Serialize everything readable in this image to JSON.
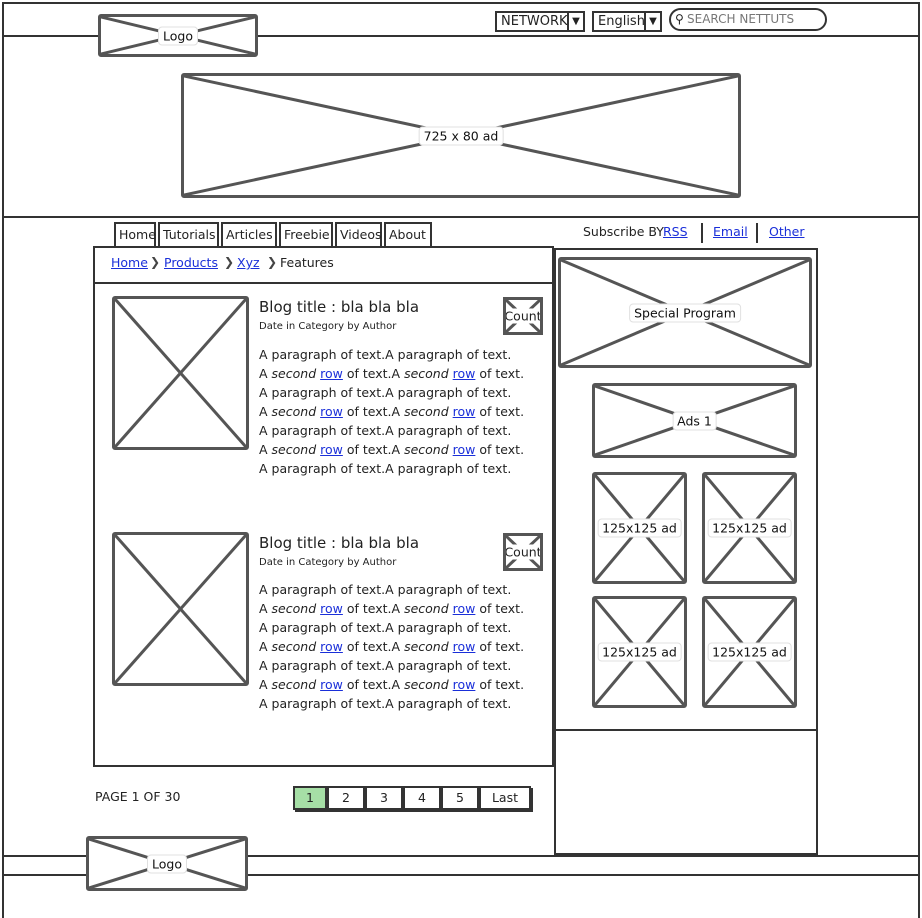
{
  "header": {
    "logo_label": "Logo",
    "network_label": "NETWORK",
    "language_label": "English",
    "search_placeholder": "SEARCH NETTUTS",
    "banner_ad_label": "725 x 80 ad"
  },
  "nav": {
    "tabs": [
      {
        "label": "Home"
      },
      {
        "label": "Tutorials"
      },
      {
        "label": "Articles"
      },
      {
        "label": "Freebie"
      },
      {
        "label": "Videos"
      },
      {
        "label": "About"
      }
    ]
  },
  "subscribe": {
    "prefix": "Subscribe BY",
    "links": [
      "RSS",
      "Email",
      "Other"
    ]
  },
  "breadcrumb": {
    "links": [
      "Home",
      "Products",
      "Xyz"
    ],
    "current": "Features"
  },
  "posts": [
    {
      "title": "Blog title : bla bla bla",
      "meta": "Date in Category by Author",
      "count_label": "Count",
      "line_a": "A paragraph of text.A paragraph of text.",
      "line_b": {
        "a": "A",
        "second": "second",
        "row": "row",
        "mid": "of text.A",
        "end": "of text."
      }
    },
    {
      "title": "Blog title : bla bla bla",
      "meta": "Date in Category by Author",
      "count_label": "Count",
      "line_a": "A paragraph of text.A paragraph of text.",
      "line_b": {
        "a": "A",
        "second": "second",
        "row": "row",
        "mid": "of text.A",
        "end": "of text."
      }
    }
  ],
  "sidebar": {
    "special_label": "Special Program",
    "ads1_label": "Ads 1",
    "small_ads": [
      "125x125 ad",
      "125x125 ad",
      "125x125 ad",
      "125x125 ad"
    ]
  },
  "pagination": {
    "info": "PAGE 1 OF 30",
    "pages": [
      "1",
      "2",
      "3",
      "4",
      "5"
    ],
    "last_label": "Last",
    "current_page": "1"
  },
  "footer": {
    "logo_label": "Logo"
  },
  "colors": {
    "link": "#1a2fd9",
    "active_page": "#a6dfa6"
  }
}
